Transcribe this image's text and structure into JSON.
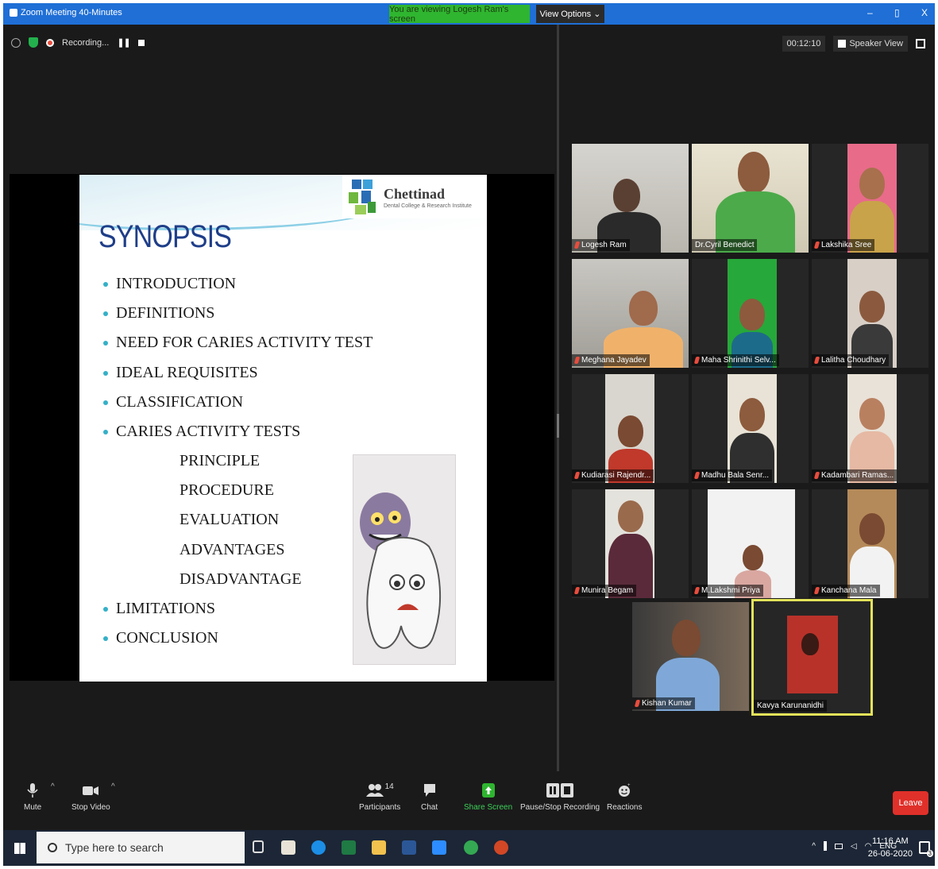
{
  "titlebar": {
    "app_title": "Zoom Meeting 40-Minutes",
    "viewing_banner": "You are viewing Logesh Ram's screen",
    "view_options": "View Options ⌄",
    "minimize": "–",
    "maximize": "▯",
    "close": "X"
  },
  "recording": {
    "label": "Recording...",
    "pause_glyph": "❚❚"
  },
  "top_right": {
    "timer": "00:12:10",
    "speaker_view": "Speaker View"
  },
  "slide": {
    "logo_name": "Chettinad",
    "logo_sub": "Dental College & Research Institute",
    "title": "SYNOPSIS",
    "bullets_top": [
      "INTRODUCTION",
      "DEFINITIONS",
      "NEED  FOR  CARIES ACTIVITY TEST",
      "IDEAL  REQUISITES",
      "CLASSIFICATION",
      "CARIES  ACTIVITY TESTS"
    ],
    "sub_items": [
      "PRINCIPLE",
      "PROCEDURE",
      "EVALUATION",
      "ADVANTAGES",
      "DISADVANTAGE"
    ],
    "bullets_bottom": [
      "LIMITATIONS",
      "CONCLUSION"
    ]
  },
  "participants": [
    {
      "name": "Logesh Ram",
      "muted": true
    },
    {
      "name": "Dr.Cyril Benedict",
      "muted": false
    },
    {
      "name": "Lakshika Sree",
      "muted": true
    },
    {
      "name": "Meghana Jayadev",
      "muted": true
    },
    {
      "name": "Maha Shrinithi Selv...",
      "muted": true
    },
    {
      "name": "Lalitha Choudhary",
      "muted": true
    },
    {
      "name": "Kudiarasi Rajendr...",
      "muted": true
    },
    {
      "name": "Madhu Bala Senr...",
      "muted": true
    },
    {
      "name": "Kadambari Ramas...",
      "muted": true
    },
    {
      "name": "Munira Begam",
      "muted": true
    },
    {
      "name": "M.Lakshmi Priya",
      "muted": true
    },
    {
      "name": "Kanchana Mala",
      "muted": true
    },
    {
      "name": "Kishan Kumar",
      "muted": true
    },
    {
      "name": "Kavya Karunanidhi",
      "muted": false
    }
  ],
  "toolbar": {
    "mute": "Mute",
    "stop_video": "Stop Video",
    "participants": "Participants",
    "participants_count": "14",
    "chat": "Chat",
    "share_screen": "Share Screen",
    "pause_stop_recording": "Pause/Stop Recording",
    "reactions": "Reactions",
    "leave": "Leave"
  },
  "taskbar": {
    "search_placeholder": "Type here to search",
    "language": "ENG",
    "time": "11:16 AM",
    "date": "26-06-2020",
    "notification_count": "3"
  },
  "colors": {
    "zoom_blue": "#1f6fd6",
    "banner_green": "#2fb52f",
    "leave_red": "#e0302a",
    "active_speaker": "#e3e35a",
    "slide_title": "#1f3e89"
  }
}
